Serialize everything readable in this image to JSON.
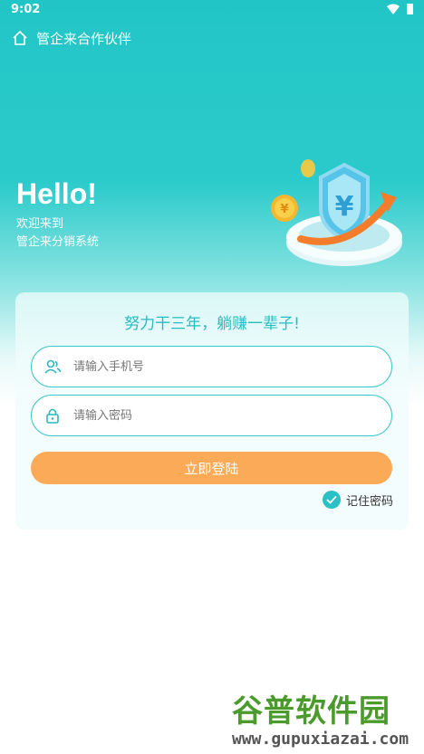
{
  "status_bar": {
    "time": "9:02"
  },
  "header": {
    "title": "管企来合作伙伴"
  },
  "hero": {
    "greeting": "Hello!",
    "welcome_line1": "欢迎来到",
    "welcome_line2": "管企来分销系统"
  },
  "card": {
    "slogan": "努力干三年，躺赚一辈子!",
    "phone_placeholder": "请输入手机号",
    "password_placeholder": "请输入密码",
    "login_label": "立即登陆",
    "remember_label": "记住密码",
    "remember_checked": true
  },
  "watermark": {
    "title": "谷普软件园",
    "url": "www.gupuxiazai.com"
  },
  "colors": {
    "accent": "#27bcc0",
    "header_bg": "#22c5c6",
    "login_button": "#fbaa57",
    "field_border": "#3cc7c8"
  },
  "icons": {
    "home": "home-icon",
    "user": "users-icon",
    "lock": "lock-icon",
    "check": "check-icon"
  }
}
